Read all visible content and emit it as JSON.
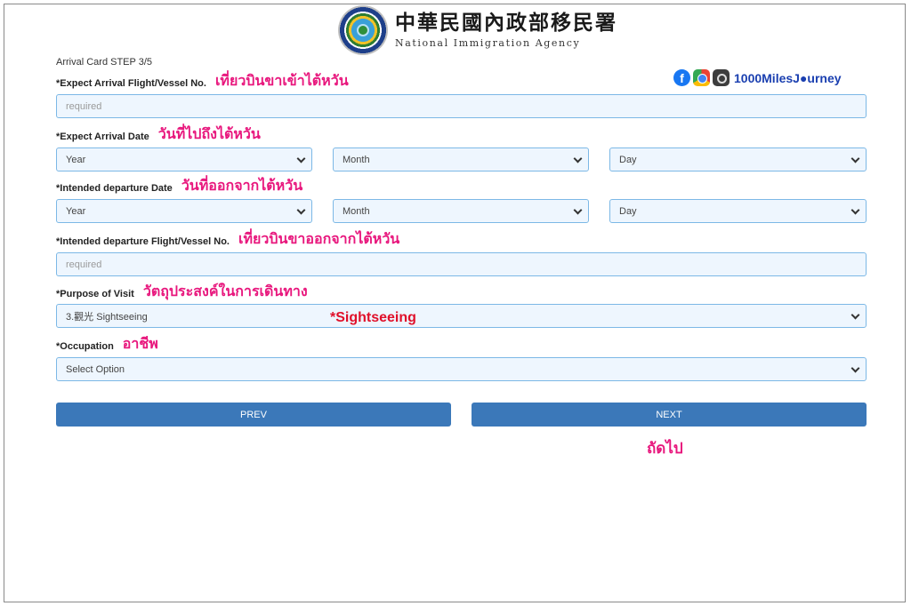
{
  "header": {
    "agency_zh": "中華民國內政部移民署",
    "agency_en": "National Immigration Agency",
    "emblem_icon": "emblem-icon"
  },
  "form": {
    "step": "Arrival Card STEP 3/5",
    "arrival_flight": {
      "label": "*Expect Arrival Flight/Vessel No.",
      "thai": "เที่ยวบินขาเข้าไต้หวัน",
      "placeholder": "required"
    },
    "arrival_date": {
      "label": "*Expect Arrival Date",
      "thai": "วันที่ไปถึงไต้หวัน",
      "year": "Year",
      "month": "Month",
      "day": "Day"
    },
    "departure_date": {
      "label": "*Intended departure Date",
      "thai": "วันที่ออกจากไต้หวัน",
      "year": "Year",
      "month": "Month",
      "day": "Day"
    },
    "departure_flight": {
      "label": "*Intended departure Flight/Vessel No.",
      "thai": "เที่ยวบินขาออกจากไต้หวัน",
      "placeholder": "required"
    },
    "purpose": {
      "label": "*Purpose of Visit",
      "thai": "วัตถุประสงค์ในการเดินทาง",
      "value": "3.觀光 Sightseeing",
      "annotation": "*Sightseeing"
    },
    "occupation": {
      "label": "*Occupation",
      "thai": "อาชีพ",
      "value": "Select Option"
    },
    "prev_label": "PREV",
    "next_label": "NEXT",
    "next_thai": "ถัดไป"
  },
  "watermark": {
    "text": "1000MilesJ●urney",
    "icons": [
      "facebook-icon",
      "chrome-icon",
      "instagram-icon"
    ]
  },
  "colors": {
    "button": "#3b78b9",
    "field_border": "#7cb8e6",
    "field_bg": "#eef6fe",
    "thai_annotation": "#e8177d",
    "red_annotation": "#e0102a"
  }
}
